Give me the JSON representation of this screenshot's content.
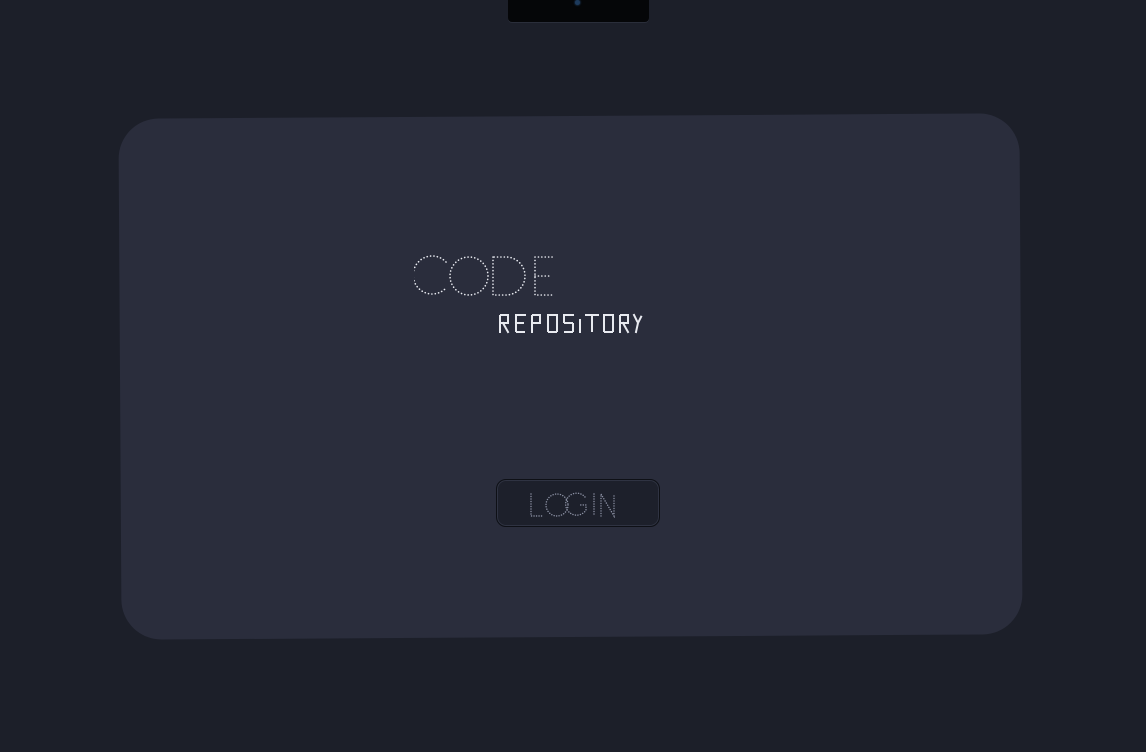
{
  "logo": {
    "title": "CODE",
    "subtitle": "REPOSITORY"
  },
  "login": {
    "label": "LOGIN"
  },
  "colors": {
    "background": "#1c1f29",
    "panel": "#2a2d3c",
    "logo_dots": "#e8eaf0",
    "button_bg": "#1d202b",
    "button_text": "#8b90a3"
  }
}
